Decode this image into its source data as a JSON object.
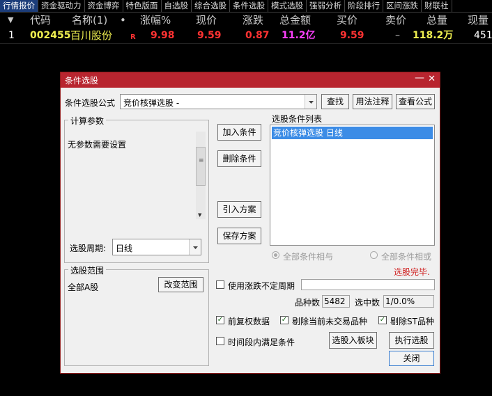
{
  "tabs": [
    "行情报价",
    "资金驱动力",
    "资金博弈",
    "特色版面",
    "自选股",
    "综合选股",
    "条件选股",
    "模式选股",
    "强弱分析",
    "阶段排行",
    "区间涨跌",
    "财联社"
  ],
  "quote_header": {
    "sort_arrow": "▼",
    "code": "代码",
    "name": "名称(1)",
    "dot": "•",
    "change_pct": "涨幅%",
    "price": "现价",
    "change": "涨跌",
    "amount": "总金额",
    "bid": "买价",
    "ask": "卖价",
    "volume": "总量",
    "cur_volume": "现量"
  },
  "quote_row": {
    "index": "1",
    "code": "002455",
    "name": "百川股份",
    "flag": "R",
    "change_pct": "9.98",
    "price": "9.59",
    "change": "0.87",
    "amount": "11.2亿",
    "bid": "9.59",
    "ask": "–",
    "volume": "118.2万",
    "cur_volume": "451"
  },
  "dialog": {
    "title": "条件选股",
    "formula_label": "条件选股公式",
    "formula_value": "竞价核弹选股 -",
    "find_btn": "查找",
    "usage_btn": "用法注释",
    "view_btn": "查看公式",
    "params_title": "计算参数",
    "params_text": "无参数需要设置",
    "period_label": "选股周期:",
    "period_value": "日线",
    "add_btn": "加入条件",
    "delete_btn": "删除条件",
    "import_btn": "引入方案",
    "save_btn": "保存方案",
    "list_title": "选股条件列表",
    "list_items": [
      "竞价核弹选股  日线"
    ],
    "and_label": "全部条件相与",
    "or_label": "全部条件相或",
    "status": "选股完毕.",
    "range_title": "选股范围",
    "range_value": "全部A股",
    "change_range_btn": "改变范围",
    "indef_label": "使用涨跌不定周期",
    "count_label": "品种数",
    "count_value": "5482",
    "selected_label": "选中数",
    "selected_value": "1/0.0%",
    "chk_fq": "前复权数据",
    "chk_exclude_untraded": "剔除当前未交易品种",
    "chk_exclude_st": "剔除ST品种",
    "chk_time": "时间段内满足条件",
    "to_block_btn": "选股入板块",
    "execute_btn": "执行选股",
    "close_btn": "关闭",
    "check_mark": "✓"
  }
}
